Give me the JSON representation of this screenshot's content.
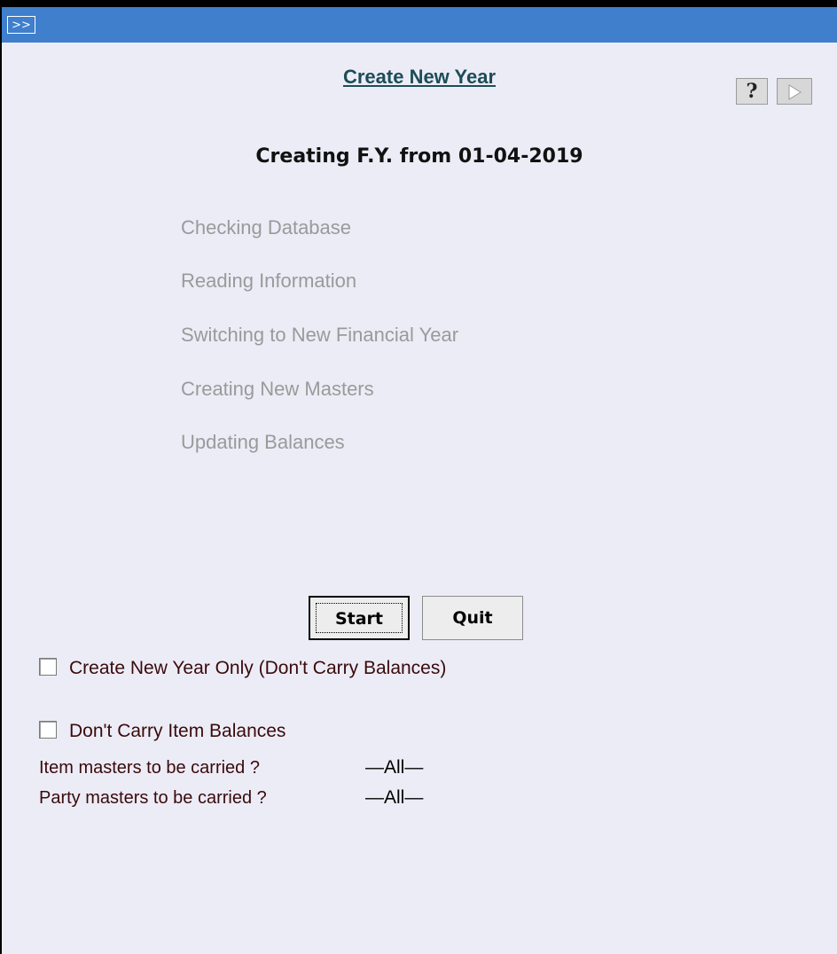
{
  "titlebar": {
    "collapse_label": ">>"
  },
  "header": {
    "title": "Create New Year",
    "help_icon": "question-mark-icon",
    "next_icon": "play-arrow-icon"
  },
  "heading": "Creating F.Y. from 01-04-2019",
  "steps": [
    "Checking Database",
    "Reading Information",
    "Switching to New Financial Year",
    "Creating New Masters",
    "Updating Balances"
  ],
  "buttons": {
    "start": "Start",
    "quit": "Quit"
  },
  "options": {
    "create_new_year_only": {
      "label": "Create New Year Only  (Don't Carry Balances)",
      "checked": false
    },
    "dont_carry_item_balances": {
      "label": "Don't Carry Item Balances",
      "checked": false
    }
  },
  "fields": {
    "item_masters": {
      "label": "Item masters to be carried ?",
      "value": "—All—"
    },
    "party_masters": {
      "label": "Party masters to be carried ?",
      "value": "—All—"
    }
  },
  "colors": {
    "titlebar": "#3f7fcc",
    "background": "#ececf7",
    "title_link": "#1c4d57",
    "step_text": "#9a9a9a",
    "label_text": "#3a0a0a"
  }
}
